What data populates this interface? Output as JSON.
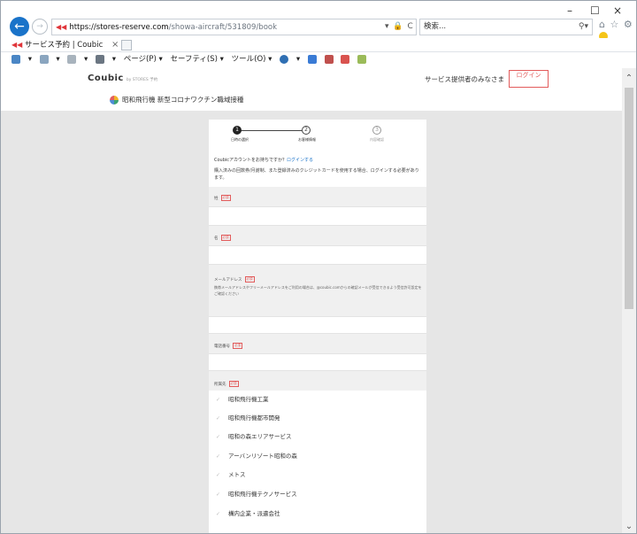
{
  "browser": {
    "url_favicon": "◀◀",
    "url_host": "https://stores-reserve.com",
    "url_path": "/showa-aircraft/531809/book",
    "url_tools": "▾ 🔒 C",
    "search_placeholder": "検索...",
    "search_icon": "search-icon",
    "tab_title": "サービス予約 | Coubic",
    "tab_close": "×",
    "win_minimize": "–",
    "win_maximize": "☐",
    "win_close": "×",
    "command_bar": [
      "ページ(P) ▾",
      "セーフティ(S) ▾",
      "ツール(O) ▾"
    ]
  },
  "site": {
    "logo": "Coubic",
    "logo_sub": "by STORES 予約",
    "provider_link": "サービス提供者のみなさま",
    "login_button": "ログイン",
    "shop_name": "昭和飛行機 新型コロナワクチン職域接種"
  },
  "steps": [
    {
      "number": "1",
      "label": "日時の選択"
    },
    {
      "number": "2",
      "label": "お客様情報"
    },
    {
      "number": "3",
      "label": "内容確認"
    }
  ],
  "intro": {
    "question": "Coubicアカウントをお持ちですか？",
    "login_link": "ログインする",
    "note": "購入済みの回数券/月謝制、また登録済みのクレジットカードを使用する場合、ログインする必要があります。"
  },
  "form": {
    "required_badge": "必須",
    "last_name_label": "姓",
    "first_name_label": "名",
    "email_label": "メールアドレス",
    "email_note": "携帯メールアドレスやフリーメールアドレスをご利用の場合は、@coubic.comからの確認メールが受信できるよう受信許可設定をご確認ください",
    "phone_label": "電話番号",
    "affiliation_label": "所属先",
    "affiliation_options": [
      "昭和飛行機工業",
      "昭和飛行機都市開発",
      "昭和の森エリアサービス",
      "アーバンリゾート昭和の森",
      "メトス",
      "昭和飛行機テクノサービス",
      "構内企業・派遣会社"
    ]
  }
}
